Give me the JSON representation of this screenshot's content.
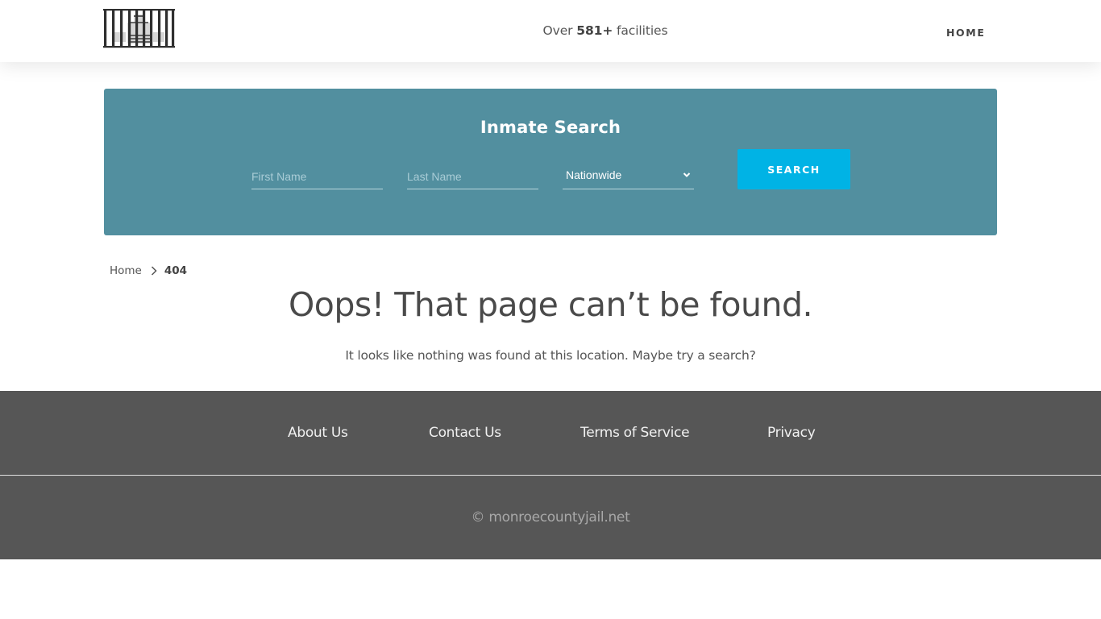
{
  "header": {
    "logo_alt": "jail-bars-logo",
    "tagline_prefix": "Over",
    "tagline_count": "581+",
    "tagline_suffix": "facilities",
    "nav": [
      {
        "label": "HOME"
      }
    ]
  },
  "search": {
    "title": "Inmate Search",
    "first_name_placeholder": "First Name",
    "first_name_value": "",
    "last_name_placeholder": "Last Name",
    "last_name_value": "",
    "location_selected": "Nationwide",
    "button_label": "SEARCH",
    "colors": {
      "panel": "#528f9f",
      "button": "#00b3e5"
    }
  },
  "breadcrumb": {
    "items": [
      {
        "label": "Home"
      },
      {
        "label": "404"
      }
    ]
  },
  "error": {
    "title": "Oops! That page can’t be found.",
    "message": "It looks like nothing was found at this location. Maybe try a search?"
  },
  "footer": {
    "links": [
      {
        "label": "About Us"
      },
      {
        "label": "Contact Us"
      },
      {
        "label": "Terms of Service"
      },
      {
        "label": "Privacy"
      }
    ],
    "copyright": "© monroecountyjail.net"
  }
}
